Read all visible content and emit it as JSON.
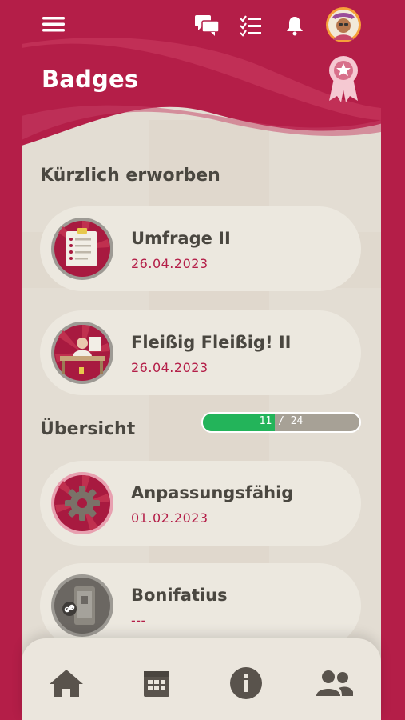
{
  "header": {
    "title": "Badges",
    "icons": [
      "menu-icon",
      "chat-icon",
      "tasks-icon",
      "bell-icon",
      "avatar",
      "award-ribbon-icon"
    ]
  },
  "recent": {
    "title": "Kürzlich erworben",
    "items": [
      {
        "title": "Umfrage II",
        "date": "26.04.2023",
        "icon": "survey-clipboard-icon"
      },
      {
        "title": "Fleißig Fleißig! II",
        "date": "26.04.2023",
        "icon": "desk-worker-icon"
      }
    ]
  },
  "overview": {
    "title": "Übersicht",
    "progress_text": "11 / 24",
    "progress_value": 11,
    "progress_total": 24,
    "items": [
      {
        "title": "Anpassungsfähig",
        "date": "01.02.2023",
        "icon": "gear-icon"
      },
      {
        "title": "Bonifatius",
        "date": "---",
        "icon": "locked-link-icon"
      }
    ]
  },
  "bottom_nav": [
    "home-icon",
    "calendar-icon",
    "info-icon",
    "group-icon"
  ],
  "colors": {
    "brand": "#b41e48",
    "panel": "#e3ddd3",
    "card": "#ece8df",
    "text": "#4a4740",
    "progress": "#23b45a"
  }
}
